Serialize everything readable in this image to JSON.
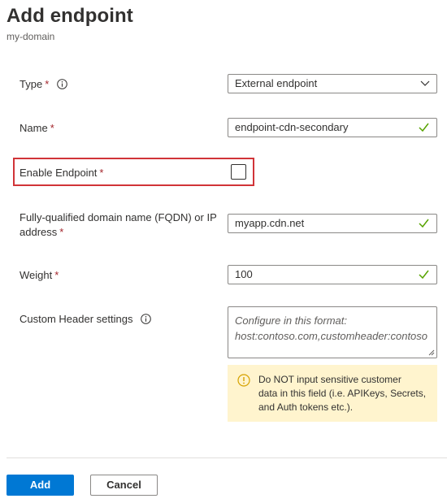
{
  "header": {
    "title": "Add endpoint",
    "subtitle": "my-domain"
  },
  "form": {
    "type": {
      "label": "Type",
      "required": "*",
      "value": "External endpoint"
    },
    "name": {
      "label": "Name",
      "required": "*",
      "value": "endpoint-cdn-secondary"
    },
    "enable_endpoint": {
      "label": "Enable Endpoint",
      "required": "*",
      "checked": false
    },
    "fqdn": {
      "label_line1": "Fully-qualified domain name (FQDN) or IP",
      "label_line2": "address",
      "required": "*",
      "value": "myapp.cdn.net"
    },
    "weight": {
      "label": "Weight",
      "required": "*",
      "value": "100"
    },
    "custom_header": {
      "label": "Custom Header settings",
      "placeholder_line1": "Configure in this format:",
      "placeholder_line2": "host:contoso.com,customheader:contoso"
    },
    "warning": {
      "line1": "Do NOT input sensitive customer",
      "line2": "data in this field (i.e. APIKeys, Secrets,",
      "line3": "and Auth tokens etc.)."
    }
  },
  "footer": {
    "add_label": "Add",
    "cancel_label": "Cancel"
  },
  "icons": {
    "info": "info-icon",
    "check": "checkmark-icon",
    "chevron": "chevron-down-icon",
    "warning": "warning-icon",
    "resize": "resize-grip-icon"
  },
  "colors": {
    "primary": "#0078d4",
    "required": "#a4262c",
    "valid_check": "#57a300",
    "highlight_border": "#d13438",
    "warning_bg": "#fff4ce",
    "warning_icon": "#d6a200"
  }
}
